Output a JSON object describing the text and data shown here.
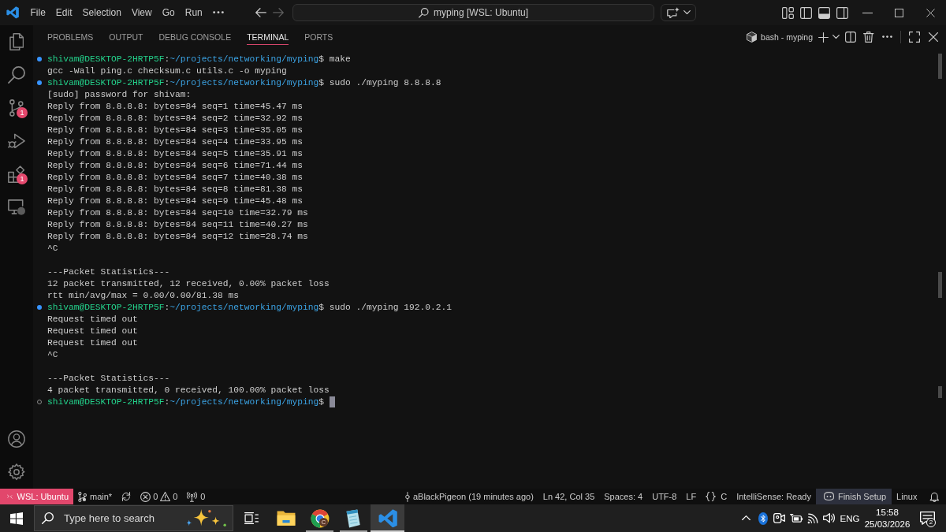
{
  "title_bar": {
    "menu": [
      "File",
      "Edit",
      "Selection",
      "View",
      "Go",
      "Run"
    ],
    "nav": [
      {
        "kind": "back",
        "disabled": false
      },
      {
        "kind": "forward",
        "disabled": true
      }
    ],
    "command_center": "myping [WSL: Ubuntu]"
  },
  "activity_bar": {
    "top": [
      {
        "kind": "explorer"
      },
      {
        "kind": "search"
      },
      {
        "kind": "source_control",
        "badge": "1"
      },
      {
        "kind": "run_debug"
      },
      {
        "kind": "extensions",
        "badge": "1"
      },
      {
        "kind": "remote_explorer"
      }
    ],
    "bottom": [
      {
        "kind": "accounts"
      },
      {
        "kind": "settings"
      }
    ]
  },
  "panel": {
    "tabs": [
      {
        "label": "PROBLEMS",
        "selected": false
      },
      {
        "label": "OUTPUT",
        "selected": false
      },
      {
        "label": "DEBUG CONSOLE",
        "selected": false
      },
      {
        "label": "TERMINAL",
        "selected": true
      },
      {
        "label": "PORTS",
        "selected": false
      }
    ],
    "terminal_name": "bash - myping"
  },
  "terminal": {
    "cursor_visible": true,
    "lines": [
      {
        "kind": "prompt",
        "completed": true,
        "user_host": "shivam@DESKTOP-2HRTP5F",
        "separator": ":",
        "path": "~/projects/networking/myping",
        "symbol": "$",
        "command": "make"
      },
      {
        "kind": "output",
        "text": "gcc -Wall ping.c checksum.c utils.c -o myping"
      },
      {
        "kind": "prompt",
        "completed": true,
        "user_host": "shivam@DESKTOP-2HRTP5F",
        "separator": ":",
        "path": "~/projects/networking/myping",
        "symbol": "$",
        "command": "sudo ./myping 8.8.8.8"
      },
      {
        "kind": "output",
        "text": "[sudo] password for shivam:"
      },
      {
        "kind": "output",
        "text": "Reply from 8.8.8.8: bytes=84 seq=1 time=45.47 ms"
      },
      {
        "kind": "output",
        "text": "Reply from 8.8.8.8: bytes=84 seq=2 time=32.92 ms"
      },
      {
        "kind": "output",
        "text": "Reply from 8.8.8.8: bytes=84 seq=3 time=35.05 ms"
      },
      {
        "kind": "output",
        "text": "Reply from 8.8.8.8: bytes=84 seq=4 time=33.95 ms"
      },
      {
        "kind": "output",
        "text": "Reply from 8.8.8.8: bytes=84 seq=5 time=35.91 ms"
      },
      {
        "kind": "output",
        "text": "Reply from 8.8.8.8: bytes=84 seq=6 time=71.44 ms"
      },
      {
        "kind": "output",
        "text": "Reply from 8.8.8.8: bytes=84 seq=7 time=40.38 ms"
      },
      {
        "kind": "output",
        "text": "Reply from 8.8.8.8: bytes=84 seq=8 time=81.38 ms"
      },
      {
        "kind": "output",
        "text": "Reply from 8.8.8.8: bytes=84 seq=9 time=45.48 ms"
      },
      {
        "kind": "output",
        "text": "Reply from 8.8.8.8: bytes=84 seq=10 time=32.79 ms"
      },
      {
        "kind": "output",
        "text": "Reply from 8.8.8.8: bytes=84 seq=11 time=40.27 ms"
      },
      {
        "kind": "output",
        "text": "Reply from 8.8.8.8: bytes=84 seq=12 time=28.74 ms"
      },
      {
        "kind": "output",
        "text": "^C"
      },
      {
        "kind": "blank"
      },
      {
        "kind": "output",
        "text": "---Packet Statistics---"
      },
      {
        "kind": "output",
        "text": "12 packet transmitted, 12 received, 0.00% packet loss"
      },
      {
        "kind": "output",
        "text": "rtt min/avg/max = 0.00/0.00/81.38 ms"
      },
      {
        "kind": "prompt",
        "completed": true,
        "user_host": "shivam@DESKTOP-2HRTP5F",
        "separator": ":",
        "path": "~/projects/networking/myping",
        "symbol": "$",
        "command": "sudo ./myping 192.0.2.1"
      },
      {
        "kind": "output",
        "text": "Request timed out"
      },
      {
        "kind": "output",
        "text": "Request timed out"
      },
      {
        "kind": "output",
        "text": "Request timed out"
      },
      {
        "kind": "output",
        "text": "^C"
      },
      {
        "kind": "blank"
      },
      {
        "kind": "output",
        "text": "---Packet Statistics---"
      },
      {
        "kind": "output",
        "text": "4 packet transmitted, 0 received, 100.00% packet loss"
      },
      {
        "kind": "prompt",
        "completed": false,
        "user_host": "shivam@DESKTOP-2HRTP5F",
        "separator": ":",
        "path": "~/projects/networking/myping",
        "symbol": "$"
      }
    ]
  },
  "status_bar": {
    "remote": "WSL: Ubuntu",
    "branch": "main*",
    "errors": "0",
    "warnings": "0",
    "ports": "0",
    "right": [
      {
        "kind": "commit",
        "text": "aBlackPigeon (19 minutes ago)"
      },
      {
        "kind": "text",
        "text": "Ln 42, Col 35"
      },
      {
        "kind": "text",
        "text": "Spaces: 4"
      },
      {
        "kind": "text",
        "text": "UTF-8"
      },
      {
        "kind": "text",
        "text": "LF"
      },
      {
        "kind": "language",
        "text": "C"
      },
      {
        "kind": "text",
        "text": "IntelliSense: Ready"
      },
      {
        "kind": "setup",
        "text": "Finish Setup"
      },
      {
        "kind": "text",
        "text": "Linux"
      },
      {
        "kind": "bell"
      }
    ]
  },
  "taskbar": {
    "search_placeholder": "Type here to search",
    "apps": [
      {
        "kind": "folder",
        "running": false,
        "selected": false
      },
      {
        "kind": "browser",
        "badge": "C",
        "running": true,
        "selected": false
      },
      {
        "kind": "notepad",
        "running": true,
        "selected": false
      },
      {
        "kind": "editor",
        "running": true,
        "selected": true
      }
    ],
    "tray": {
      "language": "ENG",
      "time": "15:58",
      "date": "25/03/2026",
      "notification_count": "2"
    }
  }
}
